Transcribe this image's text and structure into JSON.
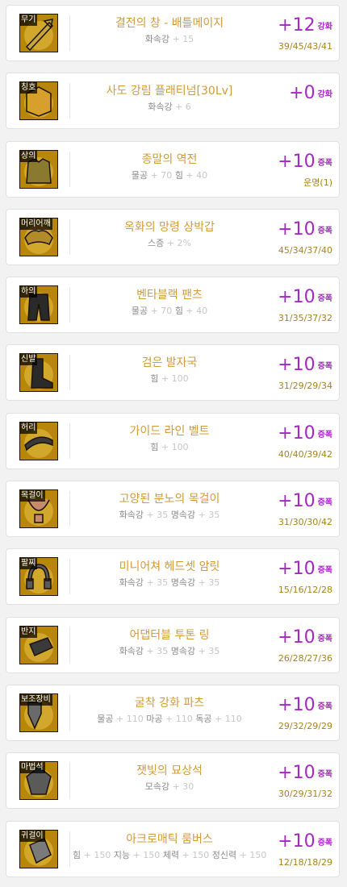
{
  "colors": {
    "item_name": "#d19a34",
    "upgrade": "#a626c6",
    "extra": "#a6821f",
    "stat_text": "#8a8a8a"
  },
  "equipment": [
    {
      "slot": "무기",
      "name": "결전의 창 - 배틀메이지",
      "stats": [
        {
          "label": "화속강",
          "value": "15"
        }
      ],
      "upgrade": "+12",
      "upgrade_type": "강화",
      "extra": "39/45/43/41",
      "icon": "spear-icon",
      "icon_color": "#c9a63c"
    },
    {
      "slot": "칭호",
      "name": "사도 강림 플래티넘[30Lv]",
      "stats": [
        {
          "label": "화속강",
          "value": "6"
        }
      ],
      "upgrade": "+0",
      "upgrade_type": "강화",
      "extra": "",
      "icon": "title-emblem-icon",
      "icon_color": "#d7a02d"
    },
    {
      "slot": "상의",
      "name": "종말의 역전",
      "stats": [
        {
          "label": "물공",
          "value": "70"
        },
        {
          "label": "힘",
          "value": "40"
        }
      ],
      "upgrade": "+10",
      "upgrade_type": "증폭",
      "extra": "운명(1)",
      "icon": "coat-icon",
      "icon_color": "#8a7a30"
    },
    {
      "slot": "머리어깨",
      "name": "옥화의 망령 상박갑",
      "stats": [
        {
          "label": "스증",
          "value": "2%"
        }
      ],
      "upgrade": "+10",
      "upgrade_type": "증폭",
      "extra": "45/34/37/40",
      "icon": "shoulder-icon",
      "icon_color": "#b38a2a"
    },
    {
      "slot": "하의",
      "name": "벤타블랙 팬츠",
      "stats": [
        {
          "label": "물공",
          "value": "70"
        },
        {
          "label": "힘",
          "value": "40"
        }
      ],
      "upgrade": "+10",
      "upgrade_type": "증폭",
      "extra": "31/35/37/32",
      "icon": "pants-icon",
      "icon_color": "#2a2a2a"
    },
    {
      "slot": "신발",
      "name": "검은 발자국",
      "stats": [
        {
          "label": "힘",
          "value": "100"
        }
      ],
      "upgrade": "+10",
      "upgrade_type": "증폭",
      "extra": "31/29/29/34",
      "icon": "boots-icon",
      "icon_color": "#2a2a2a"
    },
    {
      "slot": "허리",
      "name": "가이드 라인 벨트",
      "stats": [
        {
          "label": "힘",
          "value": "100"
        }
      ],
      "upgrade": "+10",
      "upgrade_type": "증폭",
      "extra": "40/40/39/42",
      "icon": "belt-icon",
      "icon_color": "#3a3a3a"
    },
    {
      "slot": "목걸이",
      "name": "고양된 분노의 목걸이",
      "stats": [
        {
          "label": "화속강",
          "value": "35"
        },
        {
          "label": "명속강",
          "value": "35"
        }
      ],
      "upgrade": "+10",
      "upgrade_type": "증폭",
      "extra": "31/30/30/42",
      "icon": "necklace-icon",
      "icon_color": "#c88a6a"
    },
    {
      "slot": "팔찌",
      "name": "미니어쳐 헤드셋 암릿",
      "stats": [
        {
          "label": "화속강",
          "value": "35"
        },
        {
          "label": "명속강",
          "value": "35"
        }
      ],
      "upgrade": "+10",
      "upgrade_type": "증폭",
      "extra": "15/16/12/28",
      "icon": "headset-icon",
      "icon_color": "#5a5a5a"
    },
    {
      "slot": "반지",
      "name": "어댑터블 투톤 링",
      "stats": [
        {
          "label": "화속강",
          "value": "35"
        },
        {
          "label": "명속강",
          "value": "35"
        }
      ],
      "upgrade": "+10",
      "upgrade_type": "증폭",
      "extra": "26/28/27/36",
      "icon": "ring-icon",
      "icon_color": "#3a3a3a"
    },
    {
      "slot": "보조장비",
      "name": "굴착 강화 파츠",
      "stats": [
        {
          "label": "물공",
          "value": "110"
        },
        {
          "label": "마공",
          "value": "110"
        },
        {
          "label": "독공",
          "value": "110"
        }
      ],
      "upgrade": "+10",
      "upgrade_type": "증폭",
      "extra": "29/32/29/29",
      "icon": "drill-icon",
      "icon_color": "#6a6a6a"
    },
    {
      "slot": "마법석",
      "name": "잿빛의 묘상석",
      "stats": [
        {
          "label": "모속강",
          "value": "30"
        }
      ],
      "upgrade": "+10",
      "upgrade_type": "증폭",
      "extra": "30/29/31/32",
      "icon": "magic-stone-icon",
      "icon_color": "#5a5a5a"
    },
    {
      "slot": "귀걸이",
      "name": "아크로매틱 룸버스",
      "stats": [
        {
          "label": "힘",
          "value": "150"
        },
        {
          "label": "지능",
          "value": "150"
        },
        {
          "label": "체력",
          "value": "150"
        },
        {
          "label": "정신력",
          "value": "150"
        }
      ],
      "upgrade": "+10",
      "upgrade_type": "증폭",
      "extra": "12/18/18/29",
      "icon": "earring-icon",
      "icon_color": "#7a7a7a"
    }
  ]
}
